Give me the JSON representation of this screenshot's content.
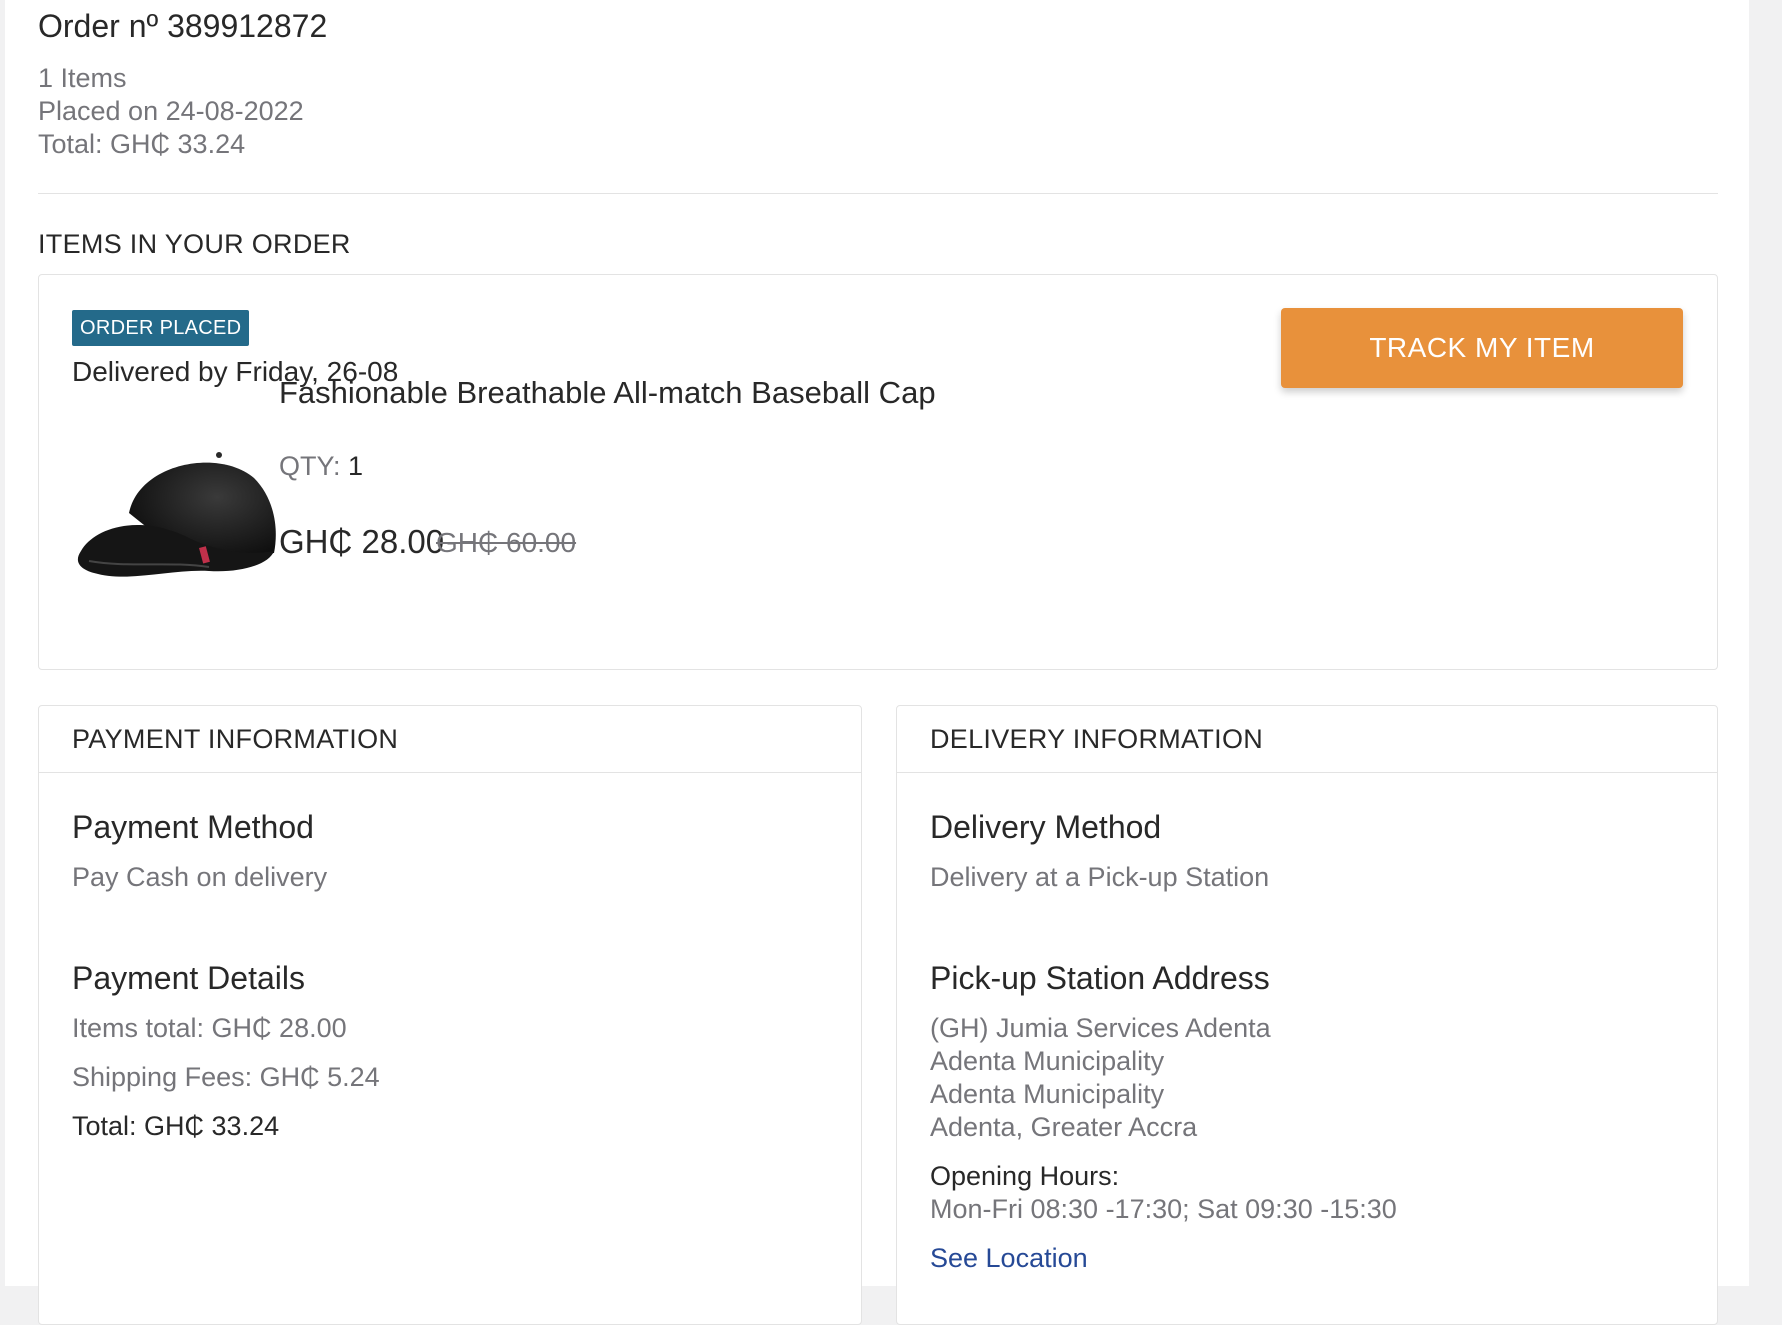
{
  "order": {
    "title": "Order nº 389912872",
    "items_count": "1 Items",
    "placed_on": "Placed on 24-08-2022",
    "total": "Total: GH₵ 33.24"
  },
  "items_section": {
    "heading": "ITEMS IN YOUR ORDER",
    "status_badge": "ORDER PLACED",
    "delivery_date": "Delivered by Friday, 26-08",
    "track_button": "TRACK MY ITEM",
    "product": {
      "name": "Fashionable Breathable All-match Baseball Cap",
      "qty_label": "QTY:",
      "qty_value": "1",
      "price": "GH₵ 28.00",
      "old_price": "GH₵ 60.00"
    }
  },
  "payment": {
    "heading": "PAYMENT INFORMATION",
    "method_title": "Payment Method",
    "method_value": "Pay Cash on delivery",
    "details_title": "Payment Details",
    "items_total": "Items total: GH₵ 28.00",
    "shipping_fees": "Shipping Fees: GH₵ 5.24",
    "total": "Total: GH₵ 33.24"
  },
  "delivery": {
    "heading": "DELIVERY INFORMATION",
    "method_title": "Delivery Method",
    "method_value": "Delivery at a Pick-up Station",
    "address_title": "Pick-up Station Address",
    "address_lines": [
      "(GH) Jumia Services Adenta",
      "Adenta Municipality",
      "Adenta Municipality",
      "Adenta, Greater Accra"
    ],
    "hours_label": "Opening Hours:",
    "hours_value": "Mon-Fri 08:30 -17:30; Sat 09:30 -15:30",
    "see_location": "See Location"
  },
  "colors": {
    "accent": "#e8913b",
    "badge": "#246a8a",
    "link": "#264996"
  }
}
